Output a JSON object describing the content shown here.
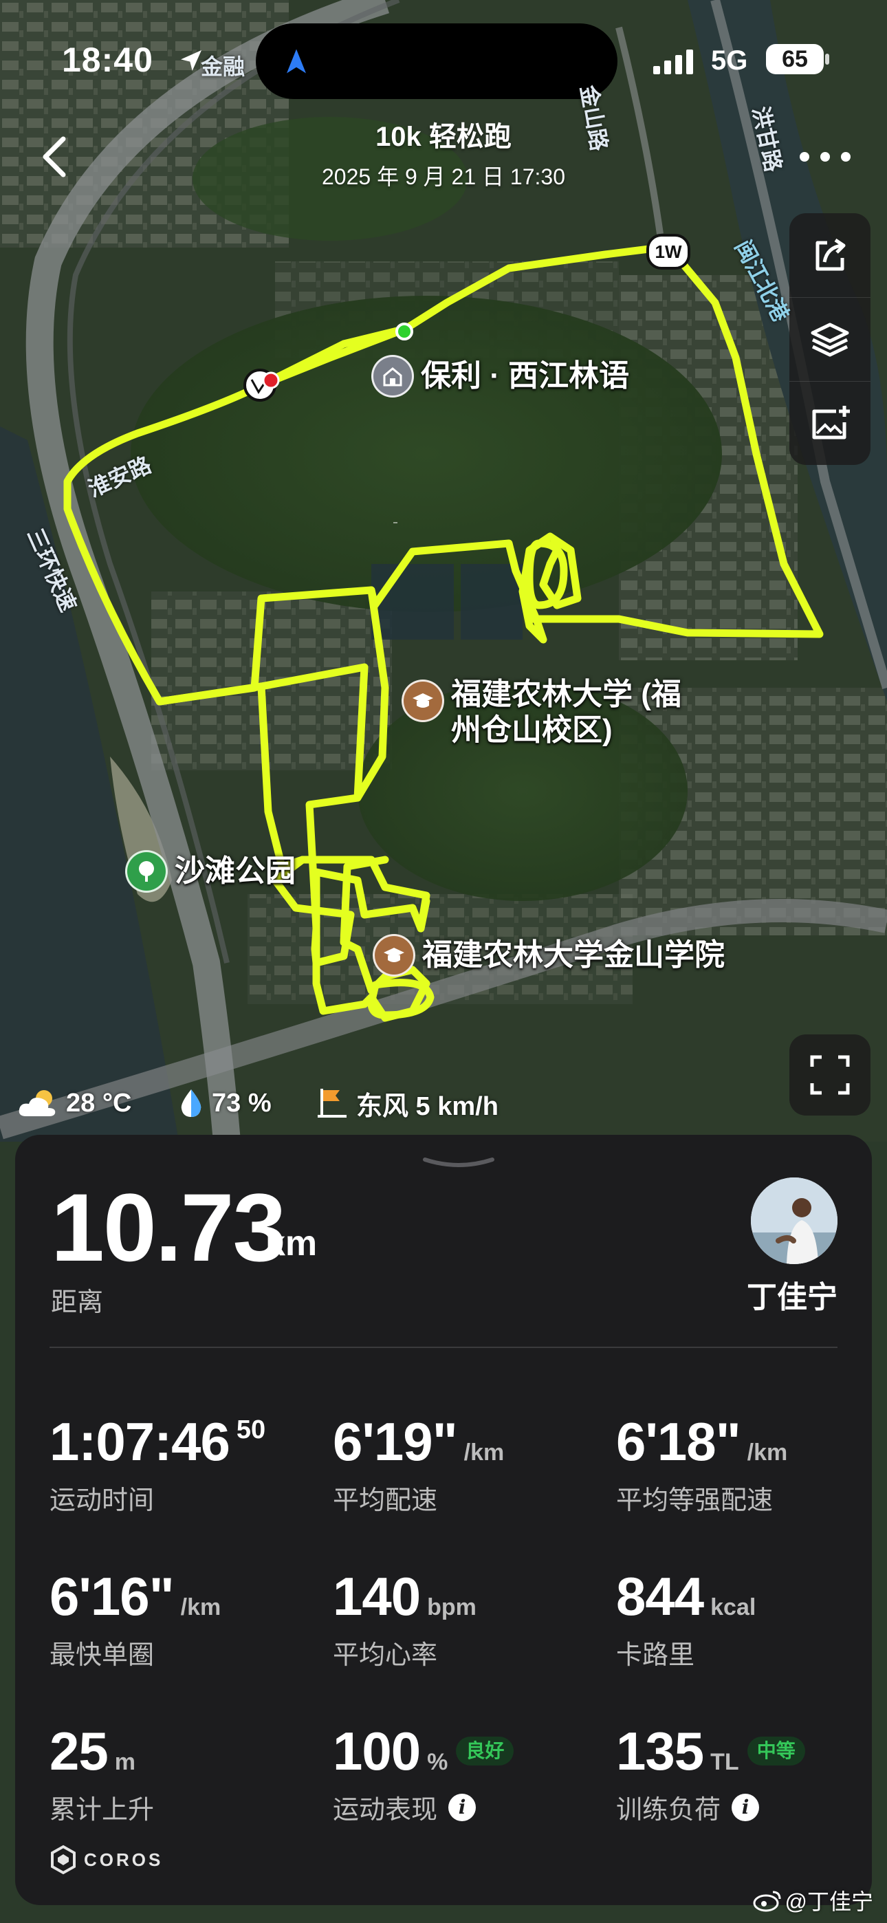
{
  "status_bar": {
    "time": "18:40",
    "network": "5G",
    "battery": "65"
  },
  "header": {
    "title": "10k 轻松跑",
    "datetime": "2025 年 9 月 21 日 17:30"
  },
  "map": {
    "pois": {
      "residence": "保利 · 西江林语",
      "university_line1": "福建农林大学 (福",
      "university_line2": "州仓山校区)",
      "park": "沙滩公园",
      "college": "福建农林大学金山学院"
    },
    "roads": {
      "top": "金融",
      "jinshan": "金山路",
      "hongganlu": "洪甘路",
      "minjiang": "闽江北港",
      "huaian": "淮安路",
      "ring": "三环快速"
    },
    "lap_marker": "1W"
  },
  "weather": {
    "temp": "28 °C",
    "humidity": "73 %",
    "wind": "东风 5 km/h"
  },
  "panel": {
    "distance": {
      "value": "10.73",
      "unit": "km",
      "label": "距离"
    },
    "user_name": "丁佳宁",
    "stats": [
      {
        "value": "1:07:46",
        "sup": "50",
        "unit": "",
        "label": "运动时间"
      },
      {
        "value": "6'19\"",
        "unit": "/km",
        "label": "平均配速"
      },
      {
        "value": "6'18\"",
        "unit": "/km",
        "label": "平均等强配速"
      },
      {
        "value": "6'16\"",
        "unit": "/km",
        "label": "最快单圈"
      },
      {
        "value": "140",
        "unit": "bpm",
        "label": "平均心率"
      },
      {
        "value": "844",
        "unit": "kcal",
        "label": "卡路里"
      },
      {
        "value": "25",
        "unit": "m",
        "label": "累计上升"
      },
      {
        "value": "100",
        "unit": "%",
        "badge": "良好",
        "label": "运动表现"
      },
      {
        "value": "135",
        "unit": "TL",
        "badge": "中等",
        "label": "训练负荷"
      }
    ],
    "info_glyph": "i",
    "brand": "COROS"
  },
  "watermark": "@丁佳宁",
  "colors": {
    "route": "#e4ff20",
    "panel_bg": "#1c1c1e",
    "badge_green": "#34c759",
    "start_dot": "#2ed12e",
    "end_dot": "#e0202a"
  }
}
